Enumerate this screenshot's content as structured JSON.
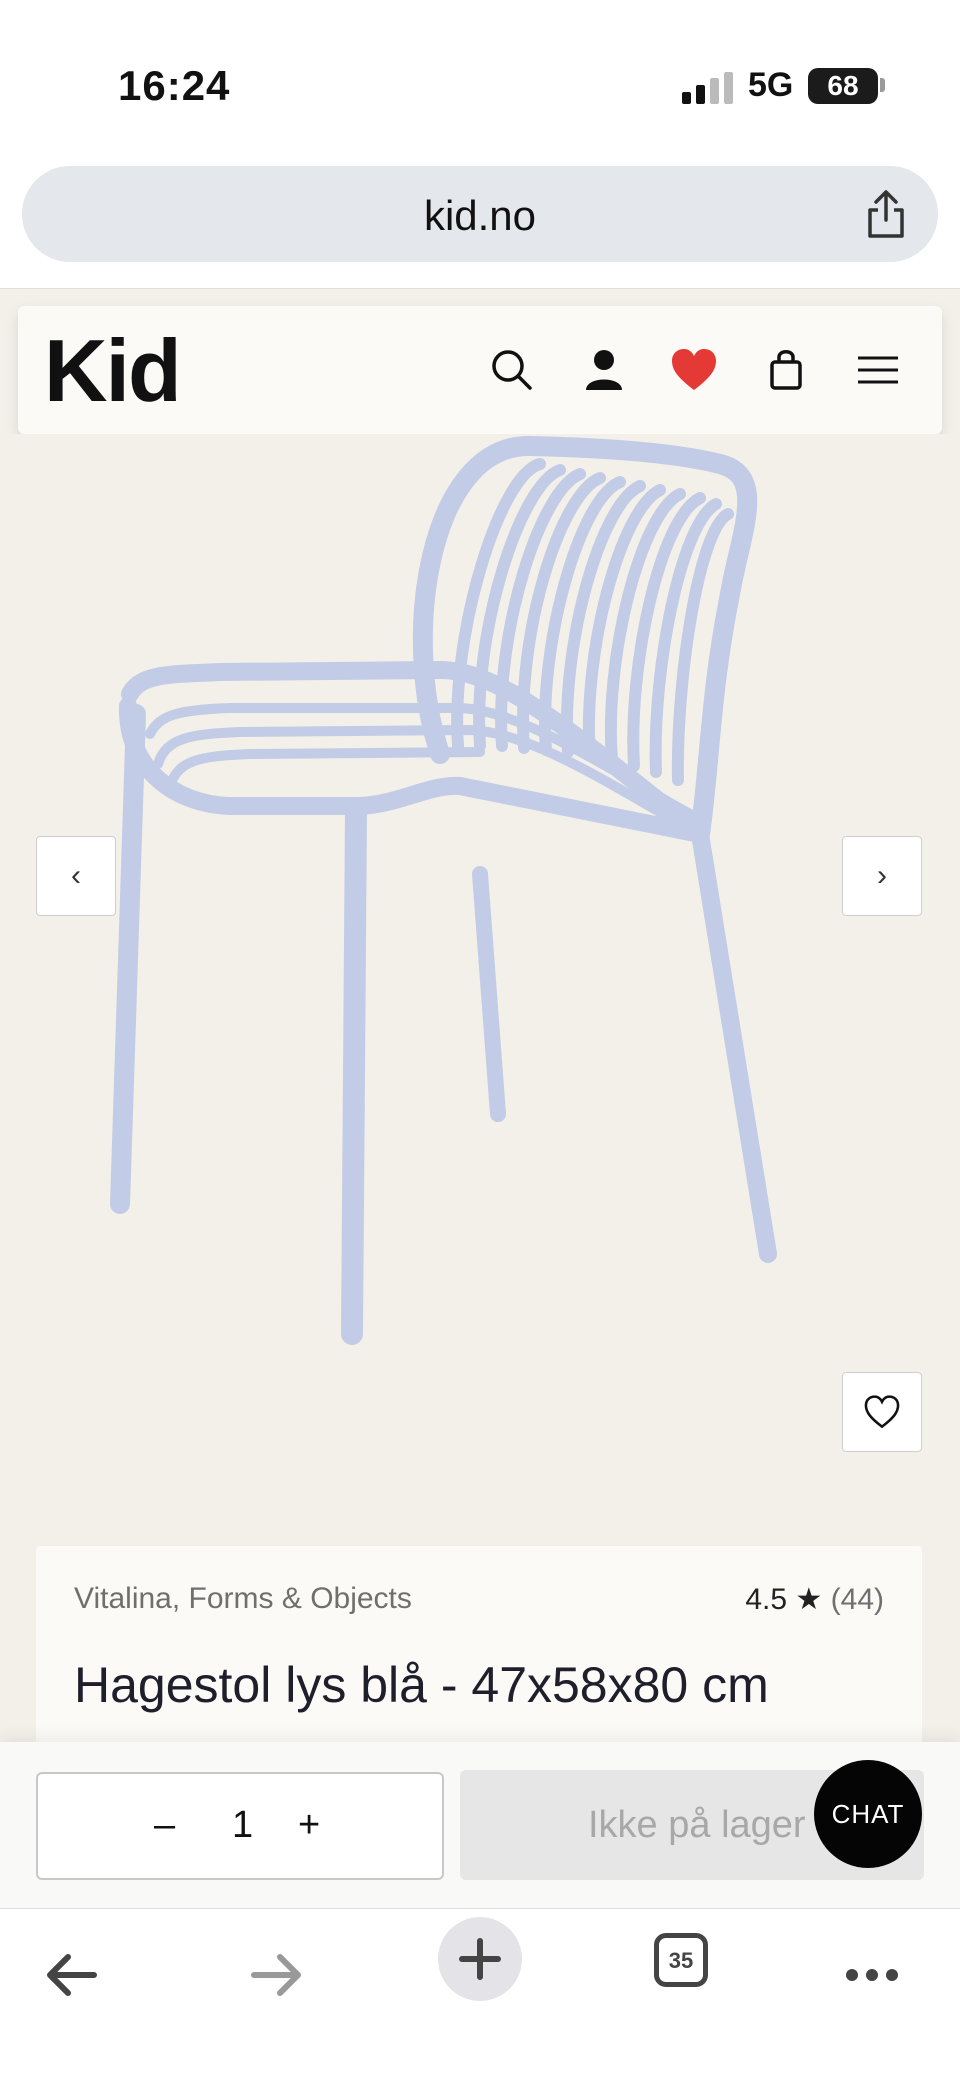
{
  "status_bar": {
    "time": "16:24",
    "network": "5G",
    "battery": "68"
  },
  "browser": {
    "url": "kid.no",
    "tabs_count": "35"
  },
  "site": {
    "logo": "Kid",
    "icons": [
      "search-icon",
      "account-icon",
      "heart-icon",
      "bag-icon",
      "menu-icon"
    ],
    "accent_color": "#e53935"
  },
  "product": {
    "prev_label": "‹",
    "next_label": "›",
    "brand": "Vitalina, Forms & Objects",
    "rating": "4.5 ★",
    "review_count": "(44)",
    "title": "Hagestol lys blå - 47x58x80 cm",
    "chair_color": "#c3cce6"
  },
  "purchase": {
    "minus": "–",
    "quantity": "1",
    "plus": "+",
    "stock_label": "Ikke på lager",
    "chat_label": "CHAT"
  }
}
